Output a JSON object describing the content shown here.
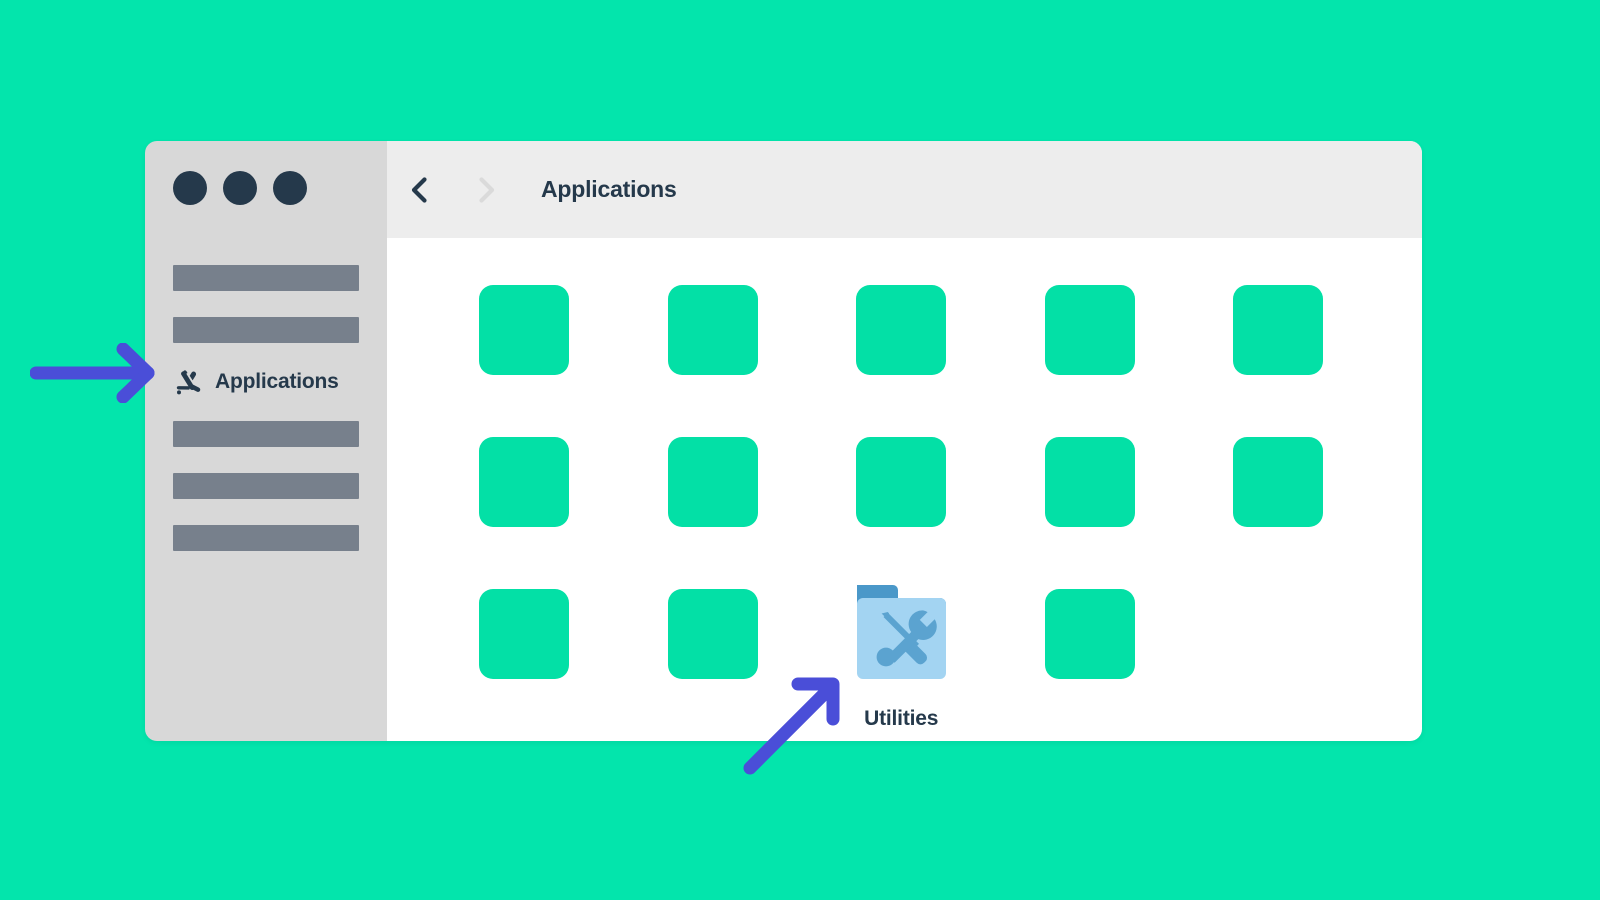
{
  "theme": {
    "background_color": "#03E5AC",
    "window_sidebar_color": "#D8D8D8",
    "window_toolbar_color": "#EDEDED",
    "content_background_color": "#FFFFFF",
    "app_tile_color": "#03E0A6",
    "placeholder_bar_color": "#77808C",
    "text_color": "#25394B",
    "annotation_arrow_color": "#4A4ED8",
    "folder_tab_color": "#4A98C9",
    "folder_body_color": "#A3D4F2",
    "folder_tool_color": "#5BA3D0"
  },
  "window": {
    "traffic_lights": [
      {
        "name": "close"
      },
      {
        "name": "minimize"
      },
      {
        "name": "zoom"
      }
    ]
  },
  "sidebar": {
    "items": [
      {
        "type": "placeholder",
        "label": ""
      },
      {
        "type": "placeholder",
        "label": ""
      },
      {
        "type": "item",
        "label": "Applications",
        "icon": "applications-icon",
        "active": true
      },
      {
        "type": "placeholder",
        "label": ""
      },
      {
        "type": "placeholder",
        "label": ""
      },
      {
        "type": "placeholder",
        "label": ""
      }
    ]
  },
  "toolbar": {
    "back_icon": "chevron-left-icon",
    "back_enabled": true,
    "forward_icon": "chevron-right-icon",
    "forward_enabled": false,
    "title": "Applications"
  },
  "grid": {
    "rows": [
      {
        "cells": [
          {
            "type": "app"
          },
          {
            "type": "app"
          },
          {
            "type": "app"
          },
          {
            "type": "app"
          },
          {
            "type": "app"
          }
        ]
      },
      {
        "cells": [
          {
            "type": "app"
          },
          {
            "type": "app"
          },
          {
            "type": "app"
          },
          {
            "type": "app"
          },
          {
            "type": "app"
          }
        ]
      },
      {
        "cells": [
          {
            "type": "app"
          },
          {
            "type": "app"
          },
          {
            "type": "folder",
            "label": "Utilities",
            "icon": "utilities-folder-icon"
          },
          {
            "type": "app"
          },
          {
            "type": "empty"
          }
        ]
      }
    ]
  },
  "annotations": [
    {
      "name": "arrow-to-applications",
      "direction": "right",
      "target": "Applications"
    },
    {
      "name": "arrow-to-utilities",
      "direction": "up-right",
      "target": "Utilities"
    }
  ]
}
